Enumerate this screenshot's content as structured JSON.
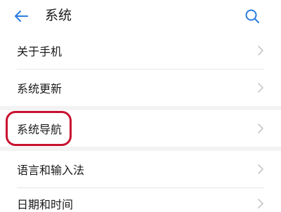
{
  "header": {
    "title": "系统",
    "back_icon": "back-arrow-icon",
    "search_icon": "search-icon"
  },
  "colors": {
    "accent": "#2a7de1",
    "chevron": "#c7c7c7",
    "section_gap": "#f3f3f3",
    "highlight": "#c8102e"
  },
  "items": [
    {
      "label": "关于手机"
    },
    {
      "label": "系统更新"
    },
    {
      "label": "系统导航"
    },
    {
      "label": "语言和输入法"
    },
    {
      "label": "日期和时间"
    }
  ]
}
